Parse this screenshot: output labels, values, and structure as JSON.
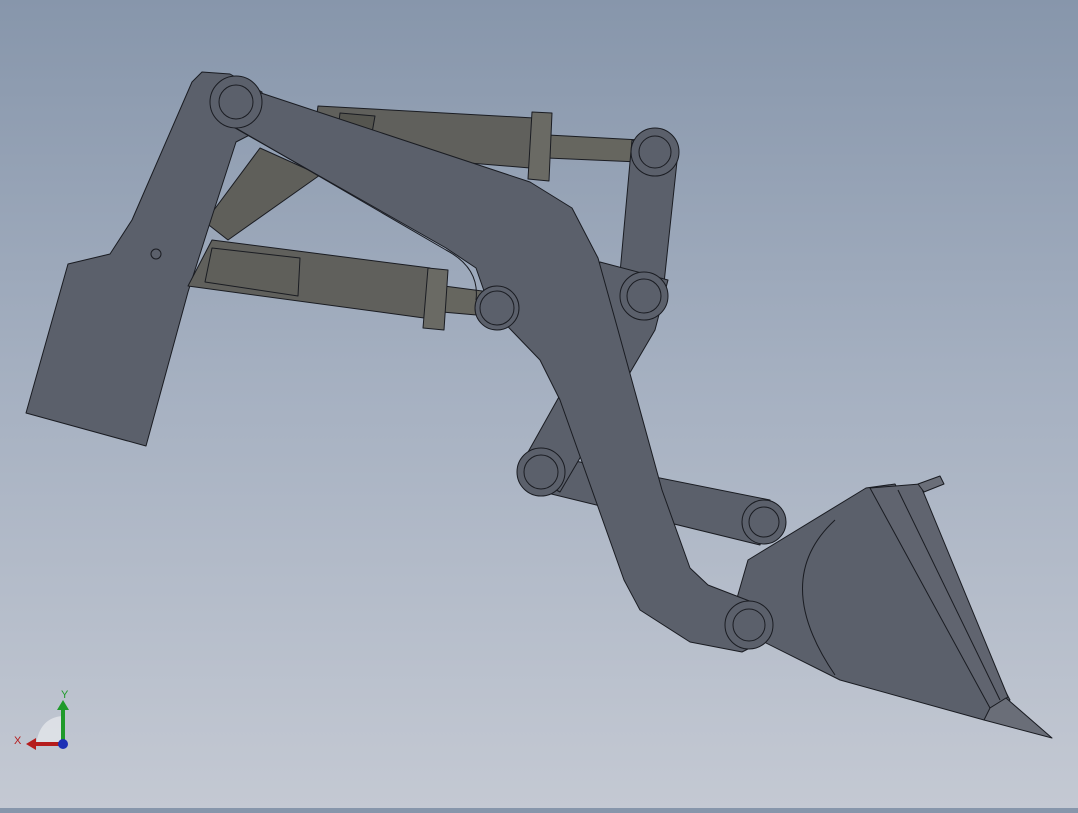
{
  "viewport": {
    "background_top": "#8796ab",
    "background_bottom": "#c4c9d3",
    "part_color": "#5b606b",
    "cylinder_color": "#60605c",
    "edge_color": "#1a1c22"
  },
  "model": {
    "components": [
      "mounting-bracket",
      "lift-arm",
      "lift-cylinder",
      "tilt-cylinder",
      "tilt-link",
      "bucket-link",
      "bucket"
    ]
  },
  "triad": {
    "x_label": "X",
    "y_label": "Y",
    "x_color": "#b51c1c",
    "y_color": "#1f9a2a",
    "z_color": "#1c2fb5"
  }
}
